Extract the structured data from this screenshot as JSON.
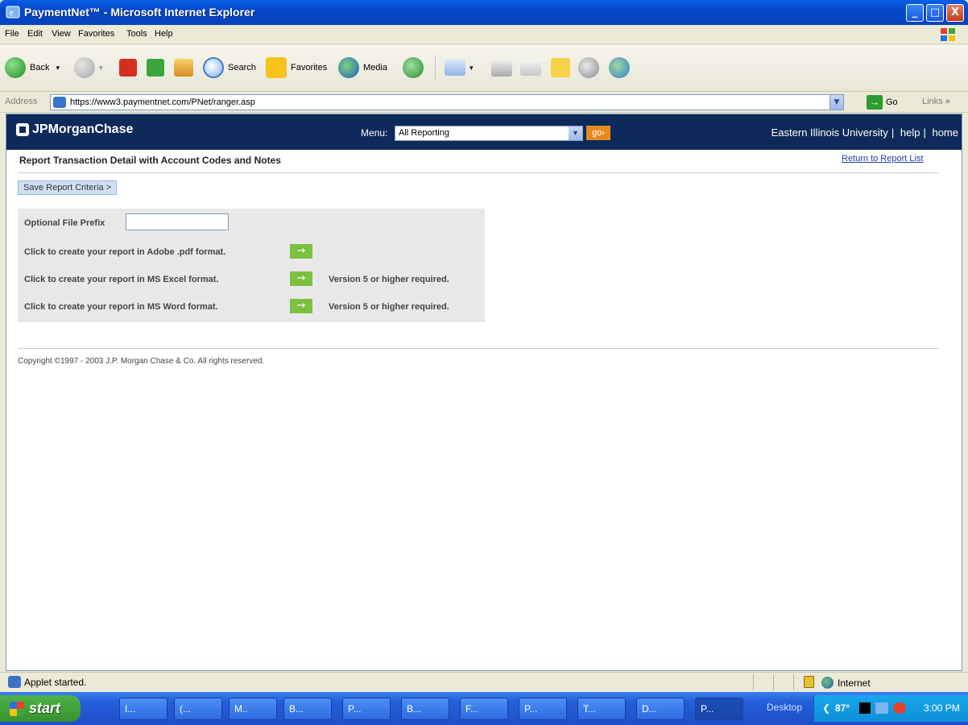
{
  "window": {
    "title": "PaymentNet™ - Microsoft Internet Explorer",
    "minimize": "_",
    "maximize": "□",
    "close": "X"
  },
  "menubar": [
    "File",
    "Edit",
    "View",
    "Favorites",
    "Tools",
    "Help"
  ],
  "toolbar": {
    "back": "Back",
    "search": "Search",
    "favorites": "Favorites",
    "media": "Media"
  },
  "address": {
    "label": "Address",
    "url": "https://www3.paymentnet.com/PNet/ranger.asp",
    "go": "Go",
    "links": "Links"
  },
  "header": {
    "logo": "JPMorganChase",
    "menu_label": "Menu:",
    "menu_value": "All Reporting",
    "go": "go›",
    "university": "Eastern Illinois University",
    "sep": "|",
    "help": "help",
    "home": "home"
  },
  "page": {
    "title": "Report Transaction Detail with Account Codes and Notes",
    "return_link": "Return to Report List",
    "save_button": "Save Report Criteria >",
    "prefix_label": "Optional File Prefix",
    "prefix_value": "",
    "pdf_label": "Click to create your report in Adobe .pdf format.",
    "excel_label": "Click to create your report in MS Excel format.",
    "word_label": "Click to create your report in MS Word format.",
    "version_note": "Version 5 or higher required.",
    "copyright": "Copyright ©1997 - 2003 J.P. Morgan Chase & Co. All rights reserved."
  },
  "status": {
    "text": "Applet started.",
    "zone": "Internet"
  },
  "taskbar": {
    "start": "start",
    "tasks": [
      "I...",
      "(...",
      "M..",
      "B...",
      "P...",
      "B...",
      "F...",
      "P...",
      "T...",
      "D...",
      "P..."
    ],
    "desktop": "Desktop",
    "temp": "87°",
    "clock": "3:00 PM"
  },
  "icons": [
    "back-icon",
    "forward-icon",
    "stop-icon",
    "refresh-icon",
    "home-icon",
    "search-icon",
    "favorites-icon",
    "media-icon",
    "history-icon",
    "mail-icon",
    "print-icon",
    "edit-icon",
    "note-icon",
    "messenger-icon",
    "people-icon"
  ]
}
